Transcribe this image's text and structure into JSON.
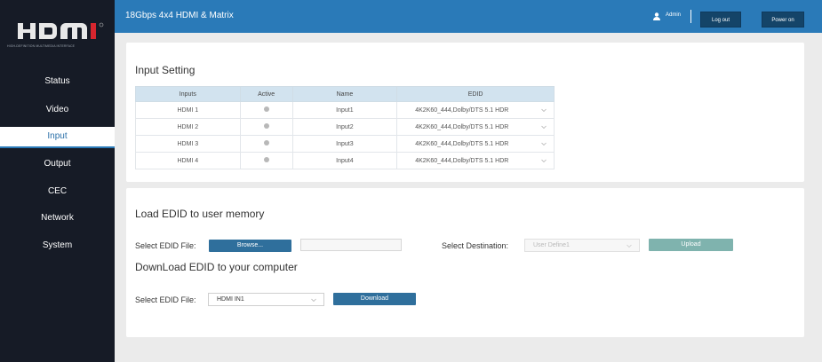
{
  "app": {
    "title": "18Gbps 4x4 HDMI & Matrix",
    "logo_sub": "HIGH-DEFINITION MULTIMEDIA INTERFACE",
    "user": "Admin",
    "logout_label": "Log out",
    "power_label": "Power on"
  },
  "sidebar": {
    "items": [
      {
        "label": "Status"
      },
      {
        "label": "Video"
      },
      {
        "label": "Input"
      },
      {
        "label": "Output"
      },
      {
        "label": "CEC"
      },
      {
        "label": "Network"
      },
      {
        "label": "System"
      }
    ],
    "active": "Input"
  },
  "input_setting": {
    "title": "Input Setting",
    "columns": [
      "Inputs",
      "Active",
      "Name",
      "EDID"
    ],
    "rows": [
      {
        "input": "HDMI 1",
        "name": "Input1",
        "edid": "4K2K60_444,Dolby/DTS 5.1 HDR"
      },
      {
        "input": "HDMI 2",
        "name": "Input2",
        "edid": "4K2K60_444,Dolby/DTS 5.1 HDR"
      },
      {
        "input": "HDMI 3",
        "name": "Input3",
        "edid": "4K2K60_444,Dolby/DTS 5.1 HDR"
      },
      {
        "input": "HDMI 4",
        "name": "Input4",
        "edid": "4K2K60_444,Dolby/DTS 5.1 HDR"
      }
    ]
  },
  "load_edid": {
    "title": "Load EDID to user memory",
    "file_label": "Select EDID File:",
    "browse_label": "Browse...",
    "dest_label": "Select Destination:",
    "dest_value": "User Define1",
    "upload_label": "Upload"
  },
  "download_edid": {
    "title": "DownLoad EDID to your computer",
    "file_label": "Select EDID File:",
    "file_value": "HDMI IN1",
    "download_label": "Download"
  },
  "colors": {
    "accent": "#2a7ab8",
    "sidebar_bg": "#161b26",
    "button": "#2f6f9c",
    "upload_button": "#7fb3ae"
  }
}
